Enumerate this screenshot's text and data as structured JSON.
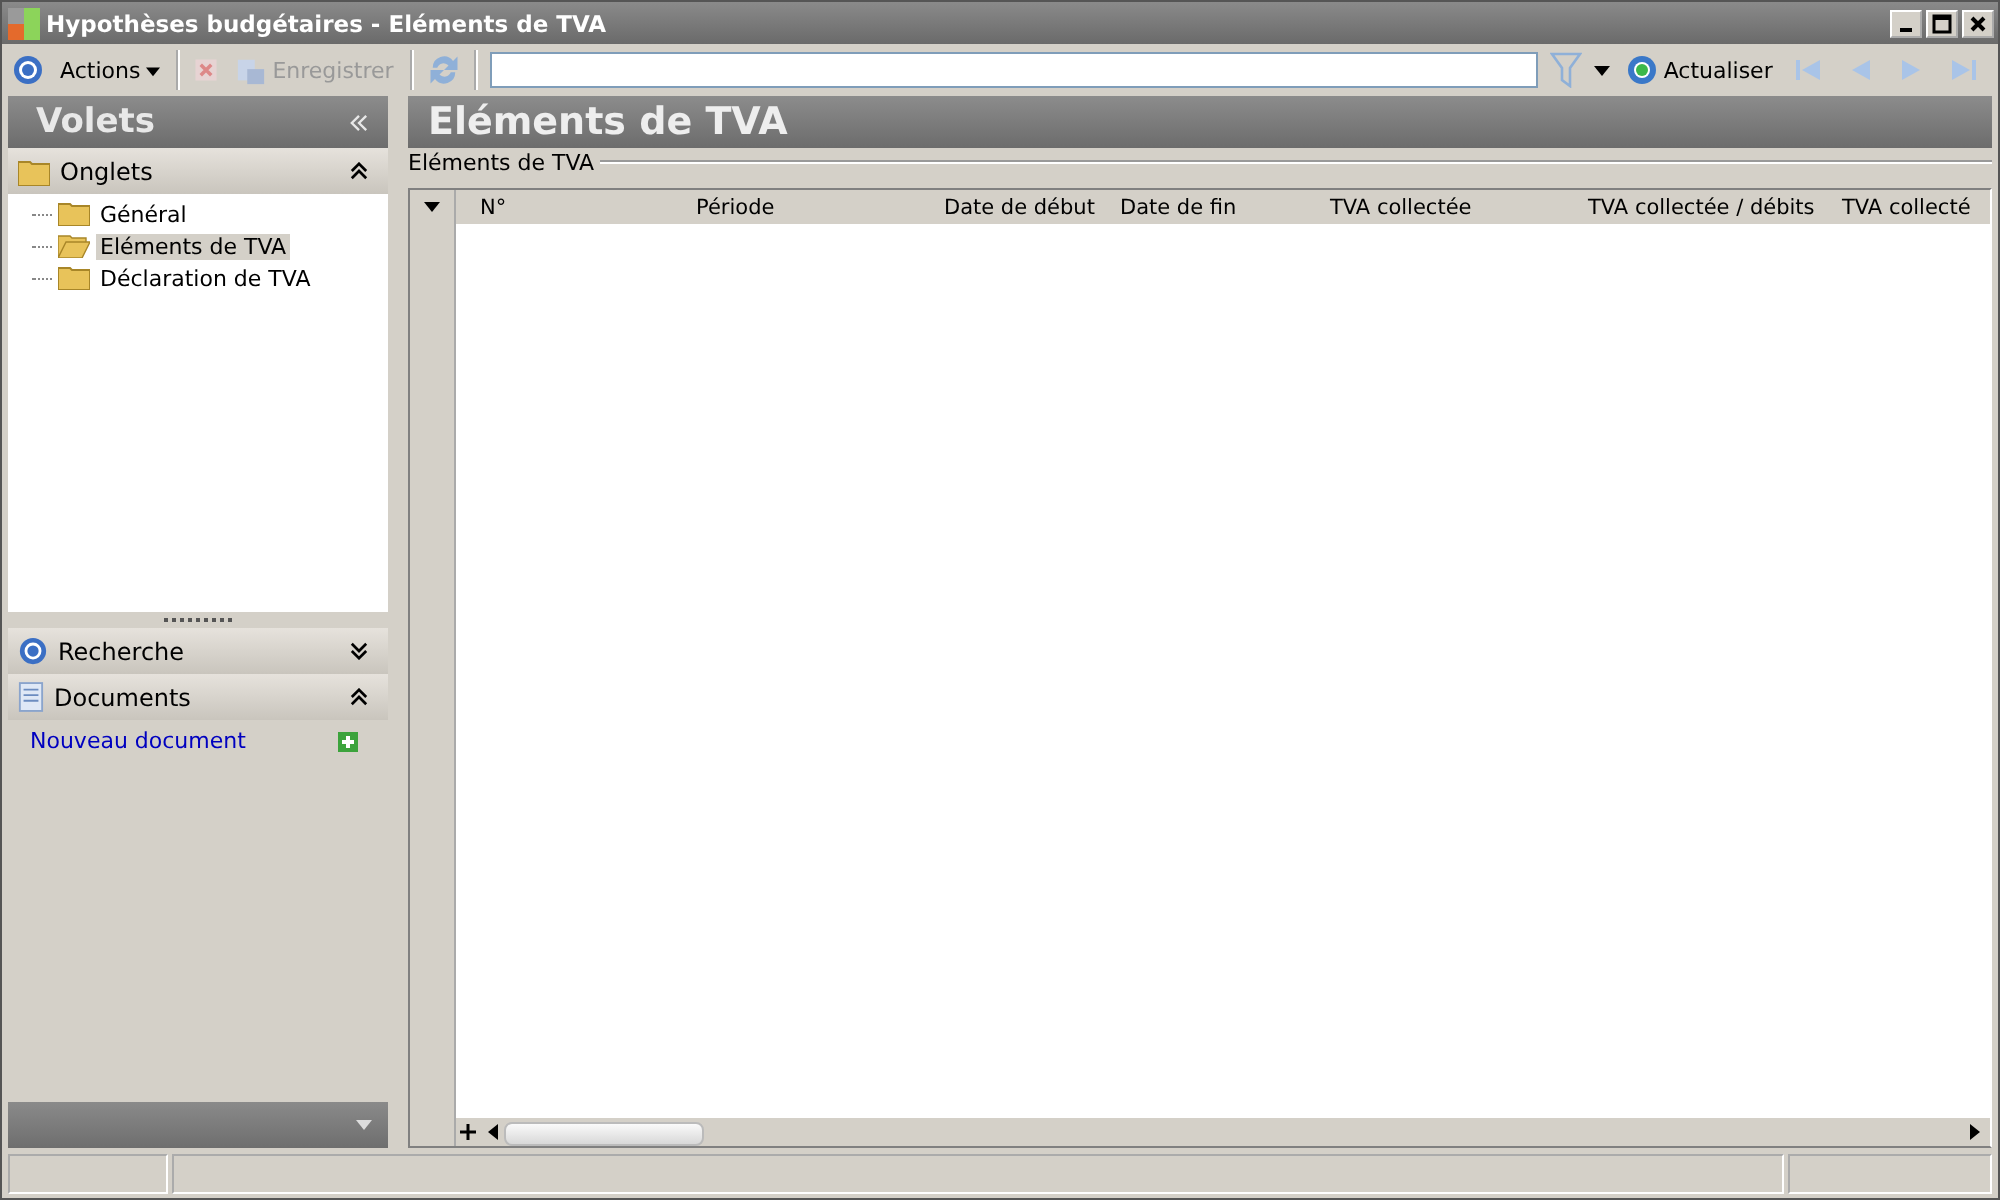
{
  "window": {
    "title": "Hypothèses budgétaires - Eléments de TVA"
  },
  "toolbar": {
    "actions": "Actions",
    "save": {
      "label": "Enregistrer",
      "disabled": true
    },
    "refresh": "Actualiser"
  },
  "sidebar": {
    "title": "Volets",
    "sections": [
      {
        "kind": "tabs",
        "title": "Onglets",
        "expanded": true,
        "items": [
          {
            "label": "Général",
            "selected": false
          },
          {
            "label": "Eléments de TVA",
            "selected": true
          },
          {
            "label": "Déclaration de TVA",
            "selected": false
          }
        ]
      },
      {
        "kind": "search",
        "title": "Recherche",
        "expanded": false
      },
      {
        "kind": "documents",
        "title": "Documents",
        "expanded": true,
        "link": "Nouveau document"
      }
    ]
  },
  "content": {
    "title": "Eléments de TVA",
    "group": "Eléments de TVA",
    "table": {
      "columns": [
        "N°",
        "Période",
        "Date de début",
        "Date de fin",
        "TVA collectée",
        "TVA collectée / débits",
        "TVA collecté"
      ]
    }
  }
}
